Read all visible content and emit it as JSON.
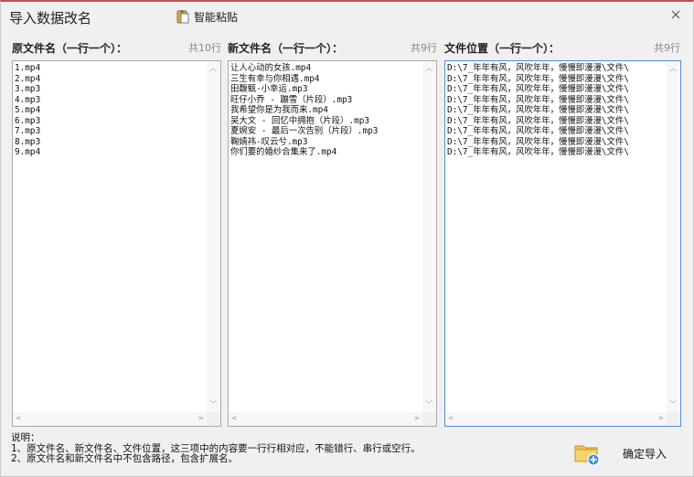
{
  "window": {
    "title": "导入数据改名",
    "paste_label": "智能粘贴",
    "close_glyph": "×"
  },
  "columns": [
    {
      "header": "原文件名（一行一个）：",
      "count": "共10行",
      "lines": [
        "1.mp4",
        "2.mp4",
        "3.mp3",
        "4.mp3",
        "5.mp4",
        "6.mp3",
        "7.mp3",
        "8.mp3",
        "9.mp4"
      ]
    },
    {
      "header": "新文件名（一行一个）：",
      "count": "共9行",
      "lines": [
        "让人心动的女孩.mp4",
        "三生有幸与你相遇.mp4",
        "田馥甄-小幸运.mp3",
        "旺仔小乔 - 蹦雪（片段）.mp3",
        "我希望你是为我而来.mp4",
        "吴大文 - 回忆中拥抱（片段）.mp3",
        "夏婉安 - 最后一次告别（片段）.mp3",
        "鞠婧祎-叹云兮.mp3",
        "你们要的婚纱合集来了.mp4"
      ]
    },
    {
      "header": "文件位置（一行一个）：",
      "count": "共9行",
      "lines": [
        "D:\\7_年年有风，风吹年年，慢慢即漫漫\\文件\\",
        "D:\\7_年年有风，风吹年年，慢慢即漫漫\\文件\\",
        "D:\\7_年年有风，风吹年年，慢慢即漫漫\\文件\\",
        "D:\\7_年年有风，风吹年年，慢慢即漫漫\\文件\\",
        "D:\\7_年年有风，风吹年年，慢慢即漫漫\\文件\\",
        "D:\\7_年年有风，风吹年年，慢慢即漫漫\\文件\\",
        "D:\\7_年年有风，风吹年年，慢慢即漫漫\\文件\\",
        "D:\\7_年年有风，风吹年年，慢慢即漫漫\\文件\\",
        "D:\\7_年年有风，风吹年年，慢慢即漫漫\\文件\\"
      ]
    }
  ],
  "notes": {
    "heading": "说明：",
    "line1": "1、原文件名、新文件名、文件位置，这三项中的内容要一行行相对应，不能错行、串行或空行。",
    "line2": "2、原文件名和新文件名中不包含路径，包含扩展名。"
  },
  "import_button": {
    "label": "确定导入"
  },
  "colors": {
    "accent": "#4d8ed8",
    "border": "#a9a9a9",
    "titlebar_line": "#c0504d"
  }
}
